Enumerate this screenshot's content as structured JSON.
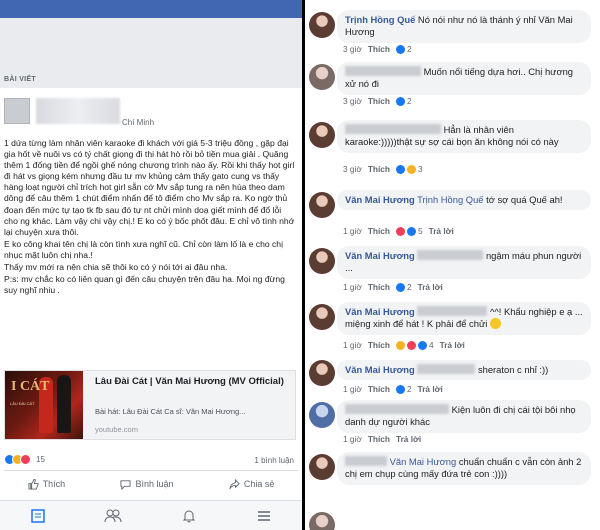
{
  "left": {
    "section_label": "BÀI VIẾT",
    "place": "Chí Minh",
    "post_paragraphs": [
      "1 dứa từng làm nhân viên karaoke đi khách với giá 5-3 triệu đồng , gặp đại gia hốt về nuôi vs có tý chất giọng đi thi hát hò rồi bỏ tiền mua giải . Quăng thêm 1 đống tiền để ngồi ghế nóng chương trình nào ấy. Rồi khi thấy hot girl đi hát vs giọng kém nhưng đầu tư mv khủng cảm thấy gato cung vs thấy hàng loạt người chỉ trích hot girl sẵn cớ Mv sắp tung ra nên hùa theo dam dông để câu thêm 1 chút điểm nhấn để tô điểm cho Mv sắp ra. Ko ngờ thủ đoạn đến mức tự tạo tk fb sau đó tự nt chửi mình doạ giết mình để đổ lỗi cho ng khác. Làm vậy chi vậy chị.! E ko có ý bốc phốt đâu. E chỉ vô tình nhớ lại chuyện xưa thôi.",
      "E ko công khai tên chị là còn tình xưa nghĩ cũ. Chỉ còn làm lố là e cho chị nhục mặt luôn chị nha.!",
      "Thấy mv mới ra nên chia sẽ thôi ko có ý nói tới ai đâu nha.",
      "P:s: mv chắc ko có liên quan gì đến câu chuyện trên đâu ha. Mọi ng đừng suy nghĩ nhiu ."
    ],
    "link_card": {
      "thumb_title": "I CÁT",
      "thumb_sub": "LÂU ĐÀI CÁT",
      "title": "Lâu Đài Cát | Văn Mai Hương (MV Official)",
      "subtitle": "Bài hát: Lâu Đài Cát Ca sĩ: Văn Mai Hương...",
      "domain": "youtube.com"
    },
    "reaction_count": "15",
    "comments_count": "1 bình luận",
    "actions": {
      "like": "Thích",
      "comment": "Bình luận",
      "share": "Chia sẻ"
    }
  },
  "right": {
    "comments": [
      {
        "name": "Trịnh Hồng Quế",
        "text": "Nó nói như nó là thánh ý nhỉ Văn Mai Hương",
        "time": "3 giờ",
        "like": "Thích",
        "reacts": "2",
        "reply": "",
        "avatar": "dark"
      },
      {
        "name": "",
        "text": "Muốn nổi tiếng dựa hơi.. Chị hương xử nó đi",
        "time": "3 giờ",
        "like": "Thích",
        "reacts": "2",
        "reply": "",
        "avatar": "gray"
      },
      {
        "name": "",
        "text": "Hẳn là nhân viên karaoke:)))))thật sự sợ cái bọn ăn không nói có này",
        "time": "3 giờ",
        "like": "Thích",
        "reacts": "3",
        "reply": "",
        "avatar": "dark"
      },
      {
        "name": "Văn Mai Hương",
        "tag": "Trịnh Hồng Quế",
        "text": "tớ sợ quá Quế ah!",
        "time": "1 giờ",
        "like": "Thích",
        "reacts": "5",
        "reply": "Trả lời",
        "avatar": "dark"
      },
      {
        "name": "Văn Mai Hương",
        "text": "ngậm máu phun người ...",
        "time": "1 giờ",
        "like": "Thích",
        "reacts": "2",
        "reply": "Trả lời",
        "avatar": "dark"
      },
      {
        "name": "Văn Mai Hương",
        "text": "^^! Khẩu nghiệp e ạ ... miệng xinh để hát ! K phải để chửi",
        "time": "1 giờ",
        "like": "Thích",
        "reacts": "4",
        "reply": "Trả lời",
        "avatar": "dark"
      },
      {
        "name": "Văn Mai Hương",
        "text": "sheraton c nhỉ :))",
        "time": "1 giờ",
        "like": "Thích",
        "reacts": "2",
        "reply": "Trả lời",
        "avatar": "dark"
      },
      {
        "name": "",
        "text": "Kiện luôn đi chị cái tội bôi nhọ danh dự người khác",
        "time": "1 giờ",
        "like": "Thích",
        "reacts": "",
        "reply": "Trả lời",
        "avatar": "blue"
      },
      {
        "name": "",
        "tag": "Văn Mai Hương",
        "text": "chuẩn chuẩn c vẫn còn ảnh 2 chị em chụp cùng mấy đứa trẻ con :))))",
        "time": "",
        "like": "",
        "reacts": "",
        "reply": "",
        "avatar": "dark"
      }
    ]
  },
  "colors": {
    "fb_blue": "#4267b2",
    "link": "#385898",
    "like": "#1877f2"
  }
}
